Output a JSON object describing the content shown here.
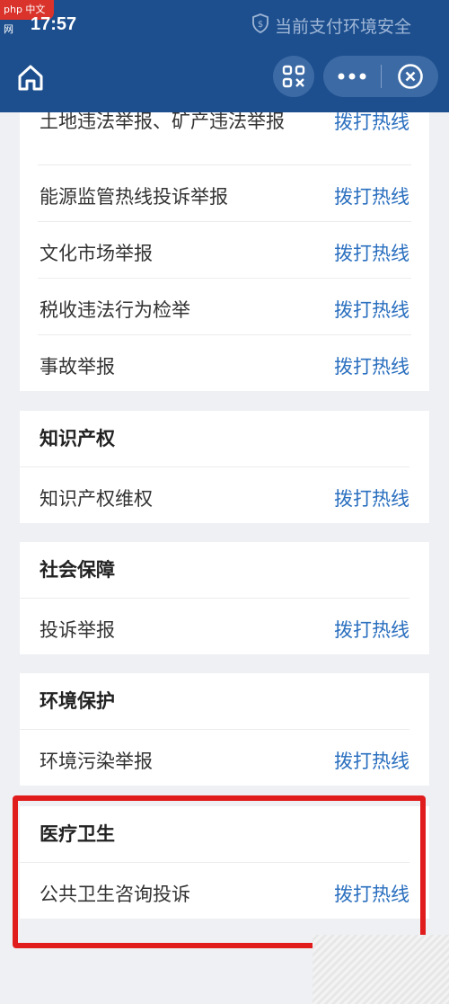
{
  "watermark": {
    "text": "php 中文网"
  },
  "status": {
    "time": "17:57",
    "security": "当前支付环境安全"
  },
  "navbar": {
    "home_icon": "home-icon",
    "scan_icon": "scan-icon",
    "more_icon": "more-dots-icon",
    "close_icon": "close-icon"
  },
  "sections": {
    "report": {
      "rows": [
        {
          "label": "土地违法举报、矿产违法举报",
          "action": "拨打热线"
        },
        {
          "label": "能源监管热线投诉举报",
          "action": "拨打热线"
        },
        {
          "label": "文化市场举报",
          "action": "拨打热线"
        },
        {
          "label": "税收违法行为检举",
          "action": "拨打热线"
        },
        {
          "label": "事故举报",
          "action": "拨打热线"
        }
      ]
    },
    "ip": {
      "title": "知识产权",
      "rows": [
        {
          "label": "知识产权维权",
          "action": "拨打热线"
        }
      ]
    },
    "social": {
      "title": "社会保障",
      "rows": [
        {
          "label": "投诉举报",
          "action": "拨打热线"
        }
      ]
    },
    "env": {
      "title": "环境保护",
      "rows": [
        {
          "label": "环境污染举报",
          "action": "拨打热线"
        }
      ]
    },
    "health": {
      "title": "医疗卫生",
      "rows": [
        {
          "label": "公共卫生咨询投诉",
          "action": "拨打热线"
        }
      ]
    }
  },
  "colors": {
    "header": "#1d4f8e",
    "link": "#2a6fbf",
    "highlight": "#e01c1c"
  }
}
